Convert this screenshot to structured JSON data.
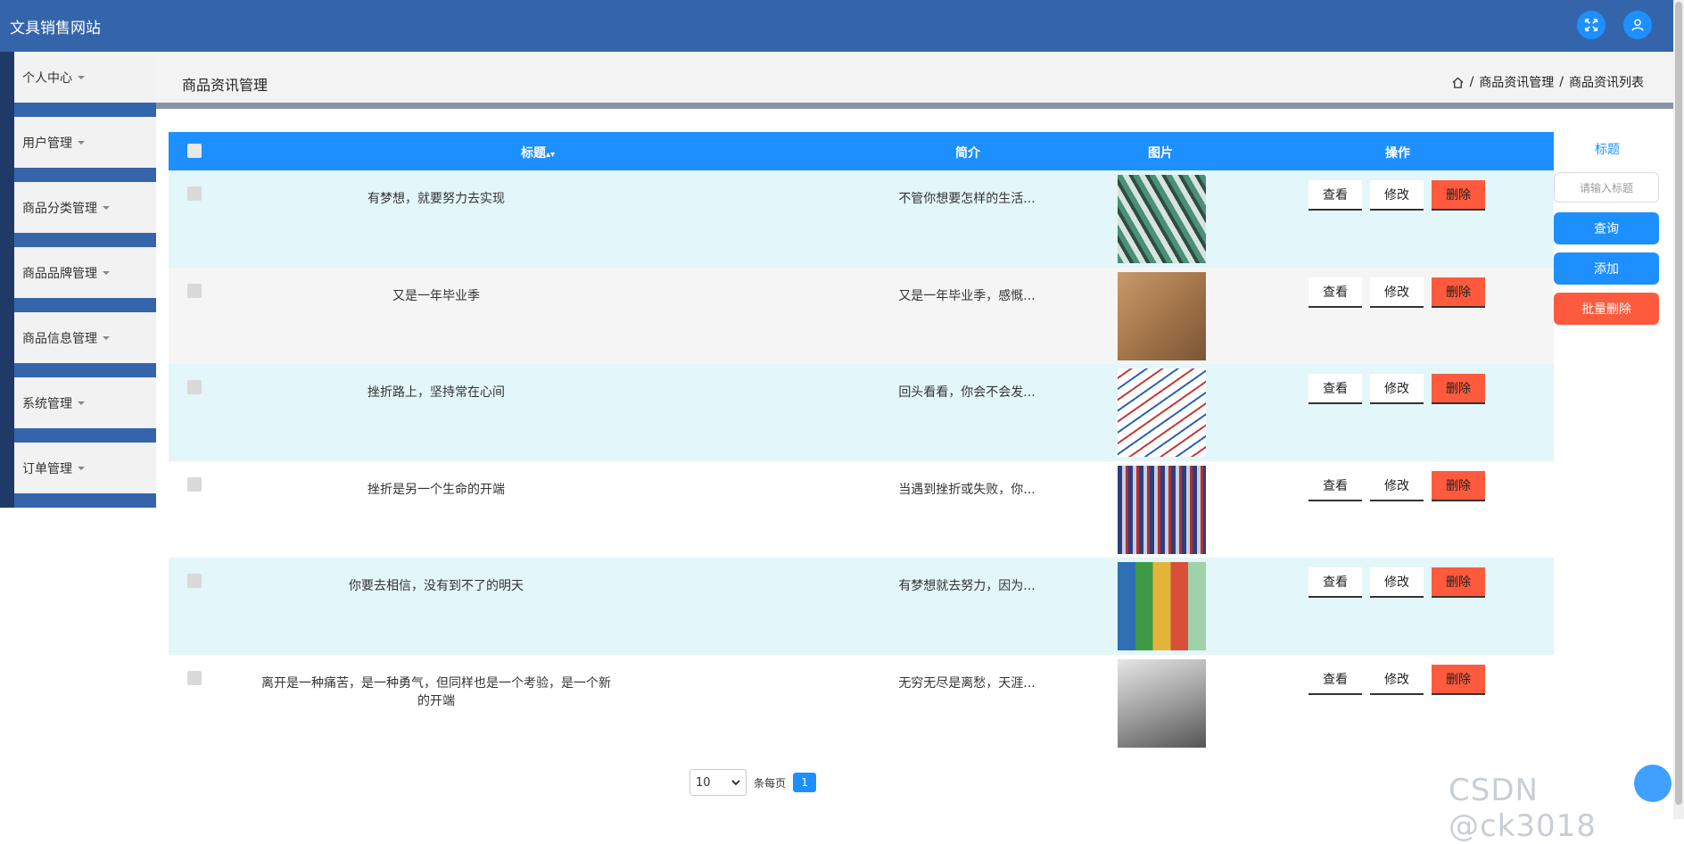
{
  "app": {
    "title": "文具销售网站"
  },
  "sidebar": {
    "items": [
      {
        "label": "个人中心"
      },
      {
        "label": "用户管理"
      },
      {
        "label": "商品分类管理"
      },
      {
        "label": "商品品牌管理"
      },
      {
        "label": "商品信息管理"
      },
      {
        "label": "系统管理"
      },
      {
        "label": "订单管理"
      }
    ]
  },
  "page": {
    "title": "商品资讯管理",
    "breadcrumb": [
      "商品资讯管理",
      "商品资讯列表"
    ]
  },
  "table": {
    "headers": {
      "title": "标题",
      "intro": "简介",
      "image": "图片",
      "action": "操作"
    },
    "rows": [
      {
        "title": "有梦想，就要努力去实现",
        "intro": "不管你想要怎样的生活..."
      },
      {
        "title": "又是一年毕业季",
        "intro": "又是一年毕业季，感慨..."
      },
      {
        "title": "挫折路上，坚持常在心间",
        "intro": "回头看看，你会不会发..."
      },
      {
        "title": "挫折是另一个生命的开端",
        "intro": "当遇到挫折或失败，你..."
      },
      {
        "title": "你要去相信，没有到不了的明天",
        "intro": "有梦想就去努力，因为..."
      },
      {
        "title": "离开是一种痛苦，是一种勇气，但同样也是一个考验，是一个新的开端",
        "intro": "无穷无尽是离愁，天涯..."
      }
    ],
    "actions": {
      "view": "查看",
      "edit": "修改",
      "delete": "删除"
    }
  },
  "search": {
    "label": "标题",
    "placeholder": "请输入标题",
    "query_btn": "查询",
    "add_btn": "添加",
    "batch_delete_btn": "批量删除"
  },
  "pagination": {
    "page_size": "10",
    "per_page_label": "条每页",
    "current": "1"
  },
  "watermark": "CSDN @ck3018",
  "colors": {
    "header": "#3465ab",
    "accent": "#1e8fff",
    "danger": "#ff5a3d",
    "row_highlight": "#e3f6fa"
  }
}
